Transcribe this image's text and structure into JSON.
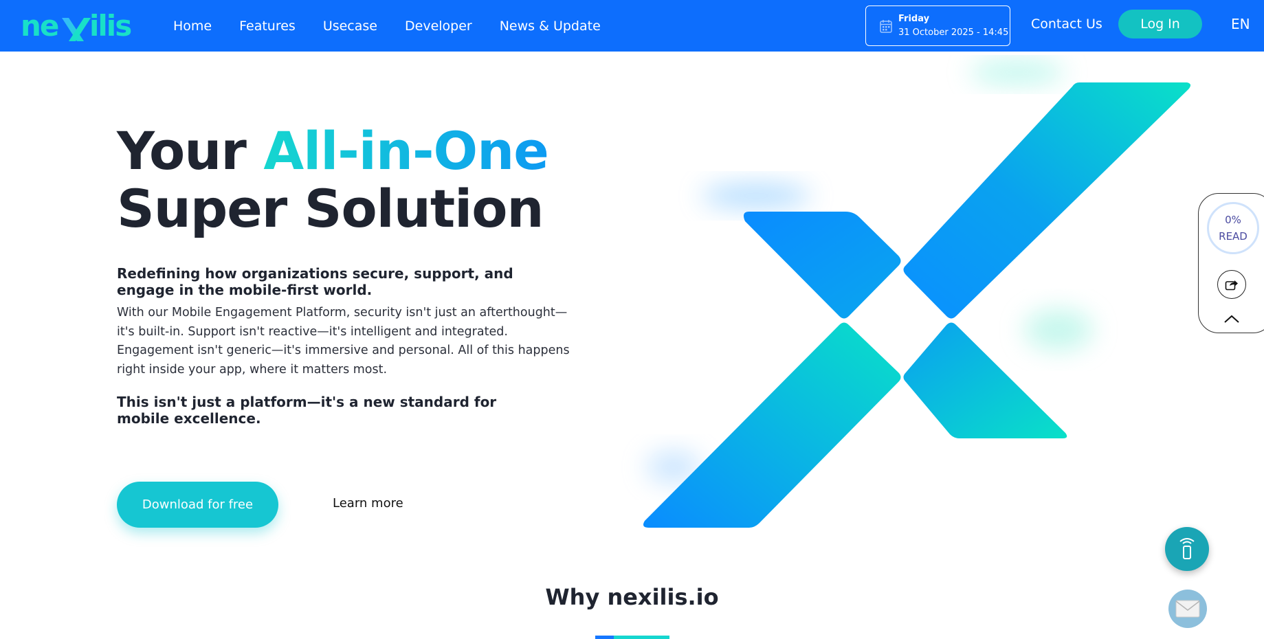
{
  "header": {
    "logo_text": "nexilis",
    "nav": [
      "Home",
      "Features",
      "Usecase",
      "Developer",
      "News & Update"
    ],
    "date_day": "Friday",
    "date_full": "31 October 2025 - 14:45",
    "contact_label": "Contact Us",
    "login_label": "Log In",
    "lang_label": "EN"
  },
  "hero": {
    "title_part1": "Your ",
    "title_accent": "All-in-One",
    "title_line2": "Super Solution",
    "lead": "Redefining how organizations secure, support, and engage in the mobile-first world.",
    "body": "With our Mobile Engagement Platform, security isn't just an afterthought—it's built-in. Support isn't reactive—it's intelligent and integrated. Engagement isn't generic—it's immersive and personal. All of this happens right inside your app, where it matters most.",
    "tagline": "This isn't just a platform—it's a new standard for mobile excellence.",
    "download_label": "Download for free",
    "learn_label": "Learn more"
  },
  "widget": {
    "read_percent": "0%",
    "read_label": "READ"
  },
  "why": {
    "title": "Why nexilis.io"
  },
  "colors": {
    "header_bg": "#0d6efd",
    "accent_teal": "#16c6d2",
    "accent_blue": "#0d9af2",
    "text_dark": "#1f2430"
  },
  "icons": {
    "calendar": "calendar-icon",
    "share": "share-icon",
    "up": "chevron-up-icon",
    "phone": "phone-signal-icon",
    "mail": "mail-icon"
  }
}
